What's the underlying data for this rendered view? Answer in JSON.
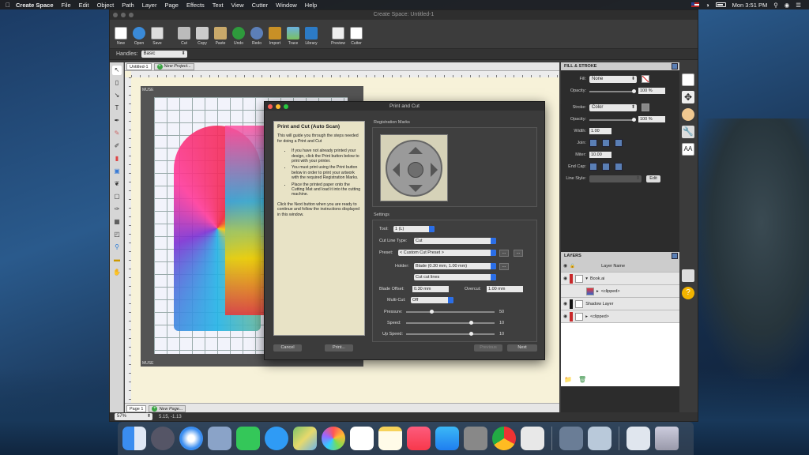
{
  "menubar": {
    "app_name": "Create Space",
    "menus": [
      "File",
      "Edit",
      "Object",
      "Path",
      "Layer",
      "Page",
      "Effects",
      "Text",
      "View",
      "Cutter",
      "Window",
      "Help"
    ],
    "clock": "Mon 3:51 PM"
  },
  "window": {
    "title": "Create Space: Untitled-1"
  },
  "toolbar": {
    "new": "New",
    "open": "Open",
    "save": "Save",
    "cut": "Cut",
    "copy": "Copy",
    "paste": "Paste",
    "undo": "Undo",
    "redo": "Redo",
    "import": "Import",
    "trace": "Trace",
    "library": "Library",
    "preview": "Preview",
    "cutter": "Cutter"
  },
  "options": {
    "handles_label": "Handles:",
    "handles_value": "Basic"
  },
  "document": {
    "tab": "Untitled-1",
    "new_project": "New Project...",
    "page_tab": "Page 1",
    "new_page": "New Page...",
    "mat_label_top": "MUSE",
    "mat_label_bottom": "MUSE"
  },
  "status": {
    "zoom": "57%",
    "coords": "5.15, -1.13"
  },
  "fill_stroke": {
    "title": "FILL & STROKE",
    "fill_label": "Fill:",
    "fill_value": "None",
    "opacity_label": "Opacity:",
    "opacity_value": "100 %",
    "stroke_label": "Stroke:",
    "stroke_value": "Color",
    "stroke_opacity_label": "Opacity:",
    "stroke_opacity_value": "100 %",
    "width_label": "Width:",
    "width_value": "1.00",
    "join_label": "Join:",
    "miter_label": "Miter:",
    "miter_value": "10.00",
    "endcap_label": "End Cap:",
    "linestyle_label": "Line Style:",
    "edit_button": "Edit",
    "opacity_fraction": 1.0
  },
  "layers": {
    "title": "LAYERS",
    "column": "Layer Name",
    "rows": [
      {
        "name": "Book.ai"
      },
      {
        "name": "<clipped>"
      },
      {
        "name": "Shadow Layer"
      },
      {
        "name": "<clipped>"
      }
    ]
  },
  "dialog": {
    "title": "Print and Cut",
    "guide_heading": "Print and Cut (Auto Scan)",
    "guide_intro": "This will guide you through the steps needed for doing a Print and Cut",
    "guide_bullets": [
      "If you have not already printed your design, click the Print button below to print with your printer.",
      "You must print using the Print button below in order to print your artwork with the required Registration Marks.",
      "Place the printed paper onto the Cutting Mat and load it into the cutting machine."
    ],
    "guide_outro": "Click the Next button when you are ready to continue and follow the instructions displayed in this window.",
    "reg_marks_label": "Registration Marks",
    "settings_label": "Settings",
    "tool_label": "Tool:",
    "tool_value": "1 (L)",
    "cut_line_type_label": "Cut Line Type:",
    "cut_line_type_value": "Cut",
    "preset_label": "Preset:",
    "preset_value": "< Custom Cut Preset >",
    "holder_label": "Holder:",
    "holder_value": "Blade (0.30 mm, 1.00 mm)",
    "cut_lines_value": "Cut cut lines",
    "blade_offset_label": "Blade Offset:",
    "blade_offset_value": "0.30 mm",
    "overcut_label": "Overcut:",
    "overcut_value": "1.00 mm",
    "multicut_label": "Multi-Cut:",
    "multicut_value": "Off",
    "pressure_label": "Pressure:",
    "pressure_value": "50",
    "speed_label": "Speed:",
    "speed_value": "10",
    "upspeed_label": "Up Speed:",
    "upspeed_value": "10",
    "dots_button": "...",
    "cancel": "Cancel",
    "print": "Print...",
    "previous": "Previous",
    "next": "Next"
  },
  "dock": {
    "apps": [
      "finder-icon",
      "launchpad-icon",
      "safari-icon",
      "mail-icon",
      "facetime-icon",
      "messages-icon",
      "maps-icon",
      "photos-icon",
      "reminders-icon",
      "notes-icon",
      "music-icon",
      "app-store-icon",
      "system-preferences-icon",
      "chrome-icon",
      "create-space-icon",
      "keychain-icon",
      "preview-icon",
      "downloads-icon",
      "trash-icon"
    ]
  }
}
